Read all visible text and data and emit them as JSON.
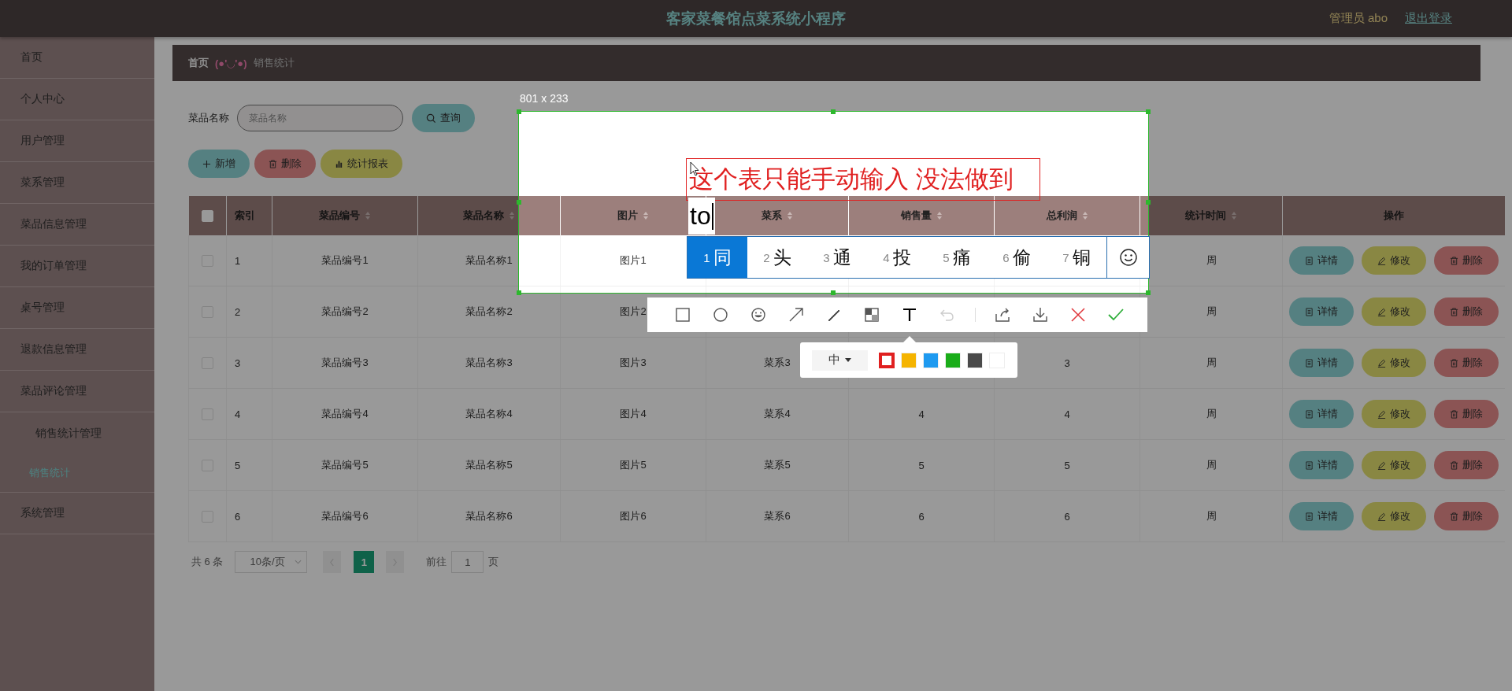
{
  "header": {
    "title": "客家菜餐馆点菜系统小程序",
    "user": "管理员 abo",
    "logout": "退出登录"
  },
  "sidebar": {
    "items": [
      {
        "label": "首页",
        "selected": false
      },
      {
        "label": "个人中心",
        "selected": false
      },
      {
        "label": "用户管理",
        "selected": false
      },
      {
        "label": "菜系管理",
        "selected": false
      },
      {
        "label": "菜品信息管理",
        "selected": false
      },
      {
        "label": "我的订单管理",
        "selected": false
      },
      {
        "label": "桌号管理",
        "selected": false
      },
      {
        "label": "退款信息管理",
        "selected": false
      },
      {
        "label": "菜品评论管理",
        "selected": false
      },
      {
        "label": "销售统计管理",
        "selected": false,
        "children": [
          {
            "label": "销售统计",
            "selected": true
          }
        ]
      },
      {
        "label": "系统管理",
        "selected": false
      }
    ]
  },
  "breadcrumb": {
    "home": "首页",
    "separator": "(●'◡'●)",
    "current": "销售统计"
  },
  "search": {
    "label": "菜品名称",
    "placeholder": "菜品名称",
    "button": "查询"
  },
  "actions": [
    {
      "kind": "add",
      "label": "新增"
    },
    {
      "kind": "delete",
      "label": "删除"
    },
    {
      "kind": "report",
      "label": "统计报表"
    }
  ],
  "table": {
    "select_all_checked": false,
    "columns": [
      {
        "label": "索引",
        "sortable": false
      },
      {
        "label": "菜品编号",
        "sortable": true
      },
      {
        "label": "菜品名称",
        "sortable": true
      },
      {
        "label": "图片",
        "sortable": true
      },
      {
        "label": "菜系",
        "sortable": true
      },
      {
        "label": "销售量",
        "sortable": true
      },
      {
        "label": "总利润",
        "sortable": true
      },
      {
        "label": "统计时间",
        "sortable": true
      },
      {
        "label": "操作",
        "sortable": false
      }
    ],
    "rows": [
      {
        "checked": false,
        "cells": [
          "1",
          "菜品编号1",
          "菜品名称1",
          "图片1",
          null,
          null,
          null,
          "周"
        ],
        "actions": [
          {
            "kind": "detail",
            "label": "详情"
          },
          {
            "kind": "edit",
            "label": "修改"
          },
          {
            "kind": "delete",
            "label": "删除"
          }
        ]
      },
      {
        "checked": false,
        "cells": [
          "2",
          "菜品编号2",
          "菜品名称2",
          "图片2",
          null,
          null,
          null,
          "周"
        ],
        "actions": [
          {
            "kind": "detail",
            "label": "详情"
          },
          {
            "kind": "edit",
            "label": "修改"
          },
          {
            "kind": "delete",
            "label": "删除"
          }
        ]
      },
      {
        "checked": false,
        "cells": [
          "3",
          "菜品编号3",
          "菜品名称3",
          "图片3",
          "菜系3",
          null,
          "3",
          "周"
        ],
        "actions": [
          {
            "kind": "detail",
            "label": "详情"
          },
          {
            "kind": "edit",
            "label": "修改"
          },
          {
            "kind": "delete",
            "label": "删除"
          }
        ]
      },
      {
        "checked": false,
        "cells": [
          "4",
          "菜品编号4",
          "菜品名称4",
          "图片4",
          "菜系4",
          "4",
          "4",
          "周"
        ],
        "actions": [
          {
            "kind": "detail",
            "label": "详情"
          },
          {
            "kind": "edit",
            "label": "修改"
          },
          {
            "kind": "delete",
            "label": "删除"
          }
        ]
      },
      {
        "checked": false,
        "cells": [
          "5",
          "菜品编号5",
          "菜品名称5",
          "图片5",
          "菜系5",
          "5",
          "5",
          "周"
        ],
        "actions": [
          {
            "kind": "detail",
            "label": "详情"
          },
          {
            "kind": "edit",
            "label": "修改"
          },
          {
            "kind": "delete",
            "label": "删除"
          }
        ]
      },
      {
        "checked": false,
        "cells": [
          "6",
          "菜品编号6",
          "菜品名称6",
          "图片6",
          "菜系6",
          "6",
          "6",
          "周"
        ],
        "actions": [
          {
            "kind": "detail",
            "label": "详情"
          },
          {
            "kind": "edit",
            "label": "修改"
          },
          {
            "kind": "delete",
            "label": "删除"
          }
        ]
      }
    ]
  },
  "pagination": {
    "total": "共 6 条",
    "page_size": "10条/页",
    "pages": [
      {
        "label": "1",
        "selected": true
      }
    ],
    "goto_label": "前往",
    "goto_value": "1",
    "goto_suffix": "页"
  },
  "screenshot_tool": {
    "size_label": "801 x 233",
    "annotation": "这个表只能手动输入 没法做到",
    "text_input": "to",
    "candidates": [
      {
        "number": "1",
        "text": "同",
        "selected": true
      },
      {
        "number": "2",
        "text": "头",
        "selected": false
      },
      {
        "number": "3",
        "text": "通",
        "selected": false
      },
      {
        "number": "4",
        "text": "投",
        "selected": false
      },
      {
        "number": "5",
        "text": "痛",
        "selected": false
      },
      {
        "number": "6",
        "text": "偷",
        "selected": false
      },
      {
        "number": "7",
        "text": "铜",
        "selected": false
      }
    ],
    "tools": [
      {
        "kind": "rect",
        "selected": false,
        "disabled": false
      },
      {
        "kind": "ellipse",
        "selected": false,
        "disabled": false
      },
      {
        "kind": "emoji",
        "selected": false,
        "disabled": false
      },
      {
        "kind": "arrow",
        "selected": false,
        "disabled": false
      },
      {
        "kind": "pen",
        "selected": false,
        "disabled": false
      },
      {
        "kind": "mosaic",
        "selected": false,
        "disabled": false
      },
      {
        "kind": "text",
        "selected": true,
        "disabled": false
      },
      {
        "kind": "undo",
        "selected": false,
        "disabled": true
      },
      {
        "kind": "share",
        "selected": false,
        "disabled": false
      },
      {
        "kind": "download",
        "selected": false,
        "disabled": false
      },
      {
        "kind": "cancel",
        "selected": false,
        "disabled": false
      },
      {
        "kind": "confirm",
        "selected": false,
        "disabled": false
      }
    ],
    "font_size": "中",
    "colors": [
      {
        "color": "#e02020",
        "selected": true
      },
      {
        "color": "#f5b400",
        "selected": false
      },
      {
        "color": "#1e9af0",
        "selected": false
      },
      {
        "color": "#1aad19",
        "selected": false
      },
      {
        "color": "#4a4a4a",
        "selected": false
      },
      {
        "color": "#ffffff",
        "selected": false
      }
    ]
  }
}
